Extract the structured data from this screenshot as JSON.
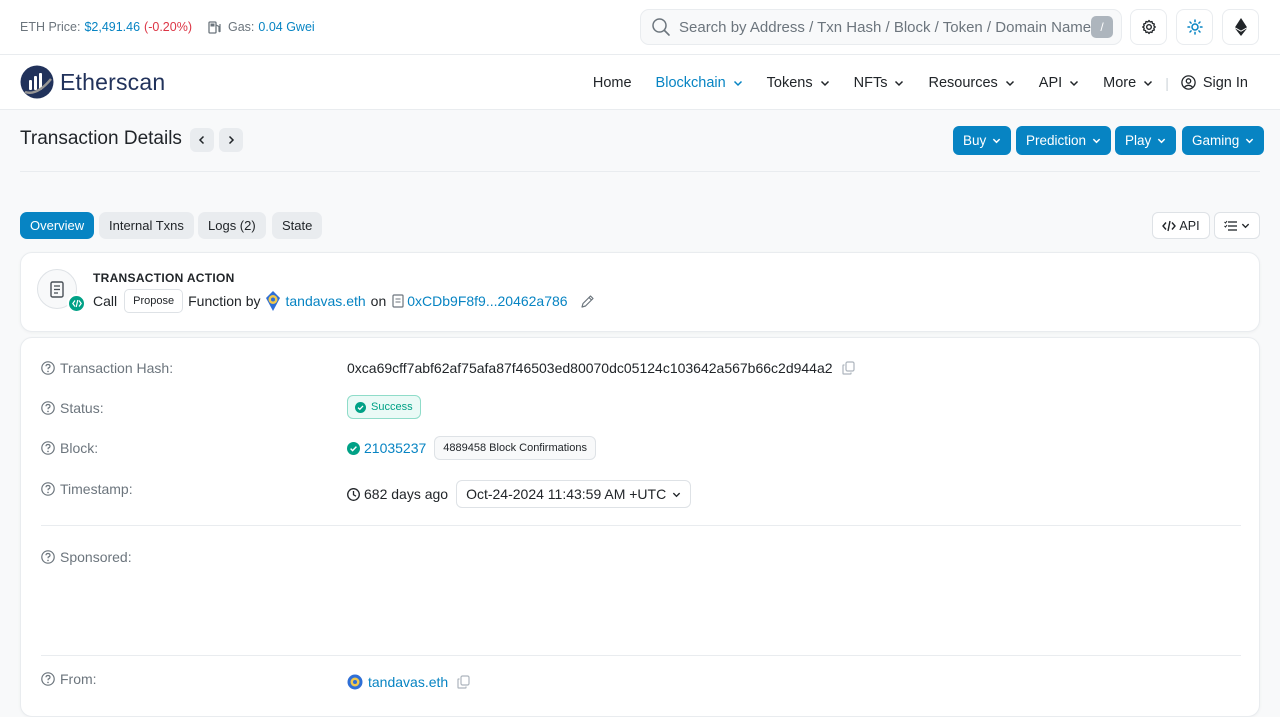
{
  "topbar": {
    "eth_price_label": "ETH Price:",
    "eth_price_value": "$2,491.46",
    "eth_price_change": "(-0.20%)",
    "gas_label": "Gas:",
    "gas_value": "0.04 Gwei",
    "search_placeholder": "Search by Address / Txn Hash / Block / Token / Domain Name",
    "search_shortcut": "/"
  },
  "navbar": {
    "brand": "Etherscan",
    "items": [
      {
        "label": "Home"
      },
      {
        "label": "Blockchain"
      },
      {
        "label": "Tokens"
      },
      {
        "label": "NFTs"
      },
      {
        "label": "Resources"
      },
      {
        "label": "API"
      },
      {
        "label": "More"
      }
    ],
    "signin": "Sign In"
  },
  "page": {
    "title": "Transaction Details",
    "buttons": [
      "Buy",
      "Prediction",
      "Play",
      "Gaming"
    ]
  },
  "tabs": [
    "Overview",
    "Internal Txns",
    "Logs (2)",
    "State"
  ],
  "api_button": "API",
  "action": {
    "label": "TRANSACTION ACTION",
    "call": "Call",
    "method": "Propose",
    "function_by": "Function by",
    "sender": "tandavas.eth",
    "on": "on",
    "contract": "0xCDb9F8f9...20462a786"
  },
  "details": {
    "tx_hash_label": "Transaction Hash:",
    "tx_hash": "0xca69cff7abf62af75afa87f46503ed80070dc05124c103642a567b66c2d944a2",
    "status_label": "Status:",
    "status": "Success",
    "block_label": "Block:",
    "block": "21035237",
    "confirmations": "4889458 Block Confirmations",
    "timestamp_label": "Timestamp:",
    "timestamp_ago": "682 days ago",
    "timestamp": "Oct-24-2024 11:43:59 AM +UTC",
    "sponsored_label": "Sponsored:",
    "from_label": "From:",
    "from": "tandavas.eth"
  },
  "colors": {
    "accent": "#0784c3",
    "success": "#00a186",
    "negative": "#dc3545"
  }
}
